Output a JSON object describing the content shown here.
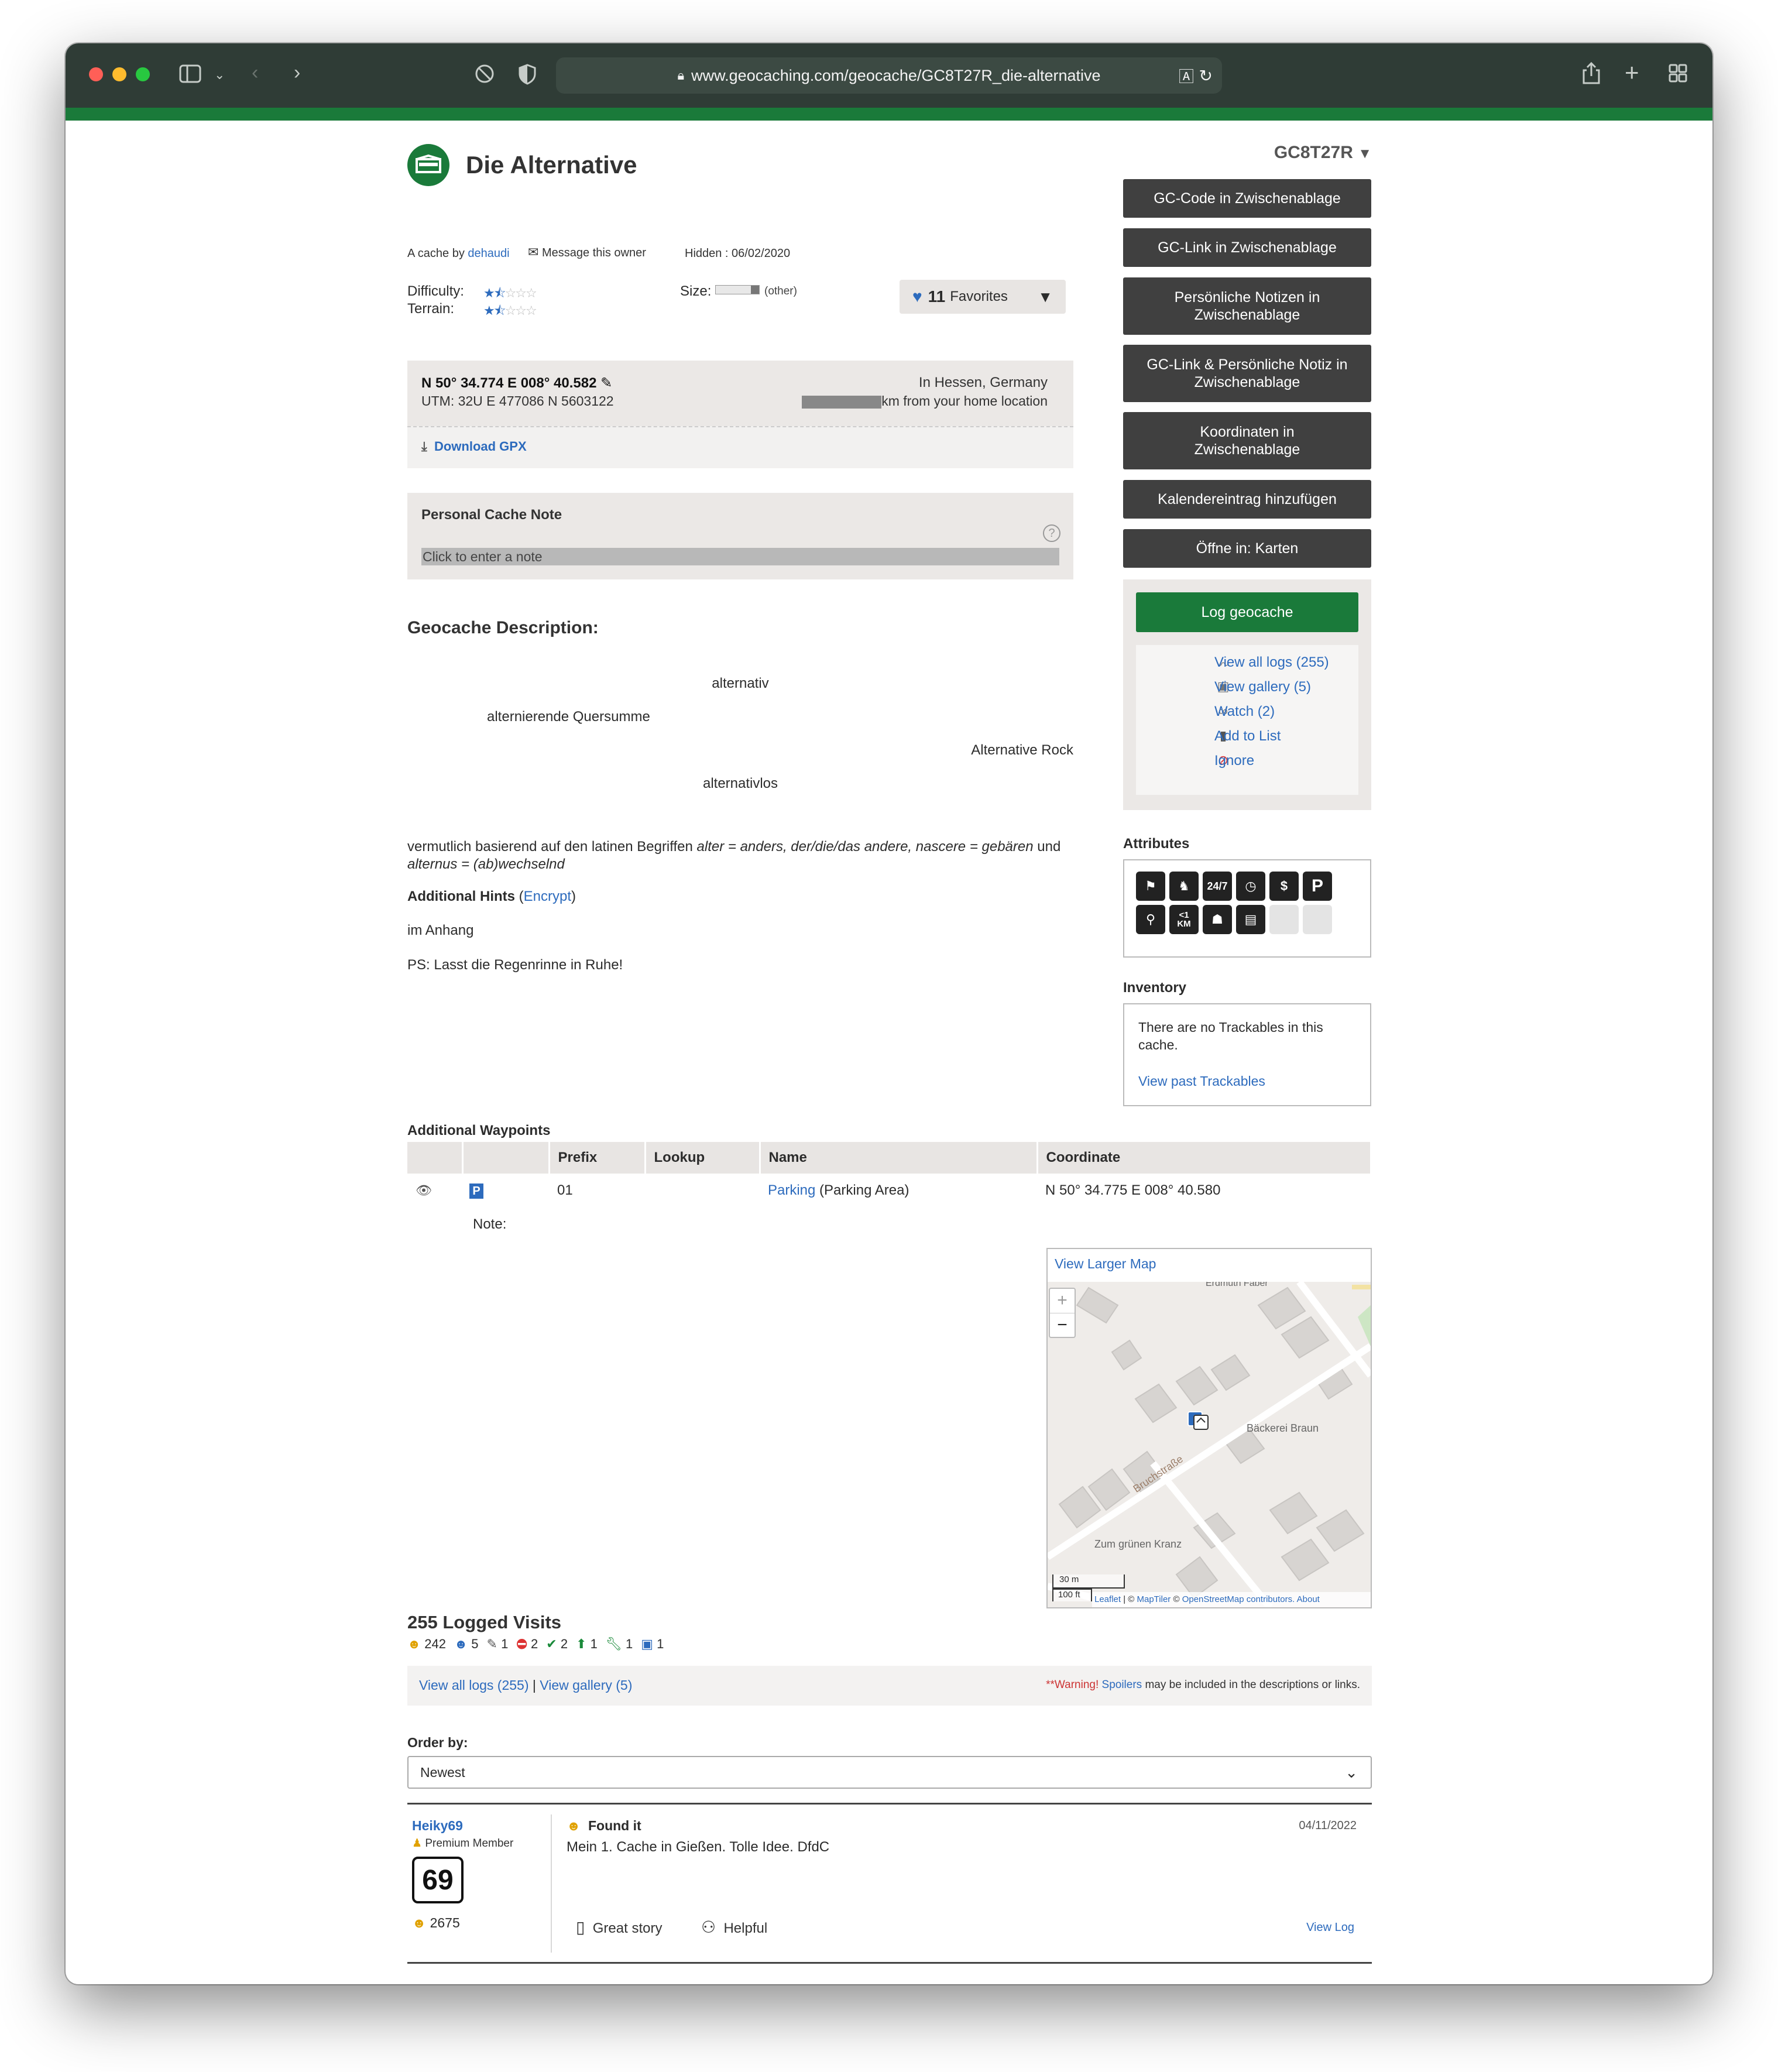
{
  "browser": {
    "url": "www.geocaching.com/geocache/GC8T27R_die-alternative",
    "lock_icon": "lock-icon",
    "translate_icon": "translate-icon"
  },
  "cache": {
    "title": "Die Alternative",
    "gc_code": "GC8T27R",
    "by_prefix": "A cache by",
    "owner": "dehaudi",
    "message_owner": "Message this owner",
    "hidden": "Hidden : 06/02/2020",
    "difficulty_label": "Difficulty:",
    "terrain_label": "Terrain:",
    "difficulty": 1.5,
    "terrain": 1.5,
    "size_label": "Size:",
    "size_value": "(other)",
    "favorites_count": "11",
    "favorites_label": "Favorites"
  },
  "coords": {
    "latlon": "N 50° 34.774 E 008° 40.582",
    "utm": "UTM: 32U E 477086 N 5603122",
    "location": "In Hessen, Germany",
    "distance": "km from your home location",
    "download_gpx": "Download GPX"
  },
  "note": {
    "heading": "Personal Cache Note",
    "placeholder": "Click to enter a note"
  },
  "description": {
    "heading": "Geocache Description:",
    "line1": "alternativ",
    "line2": "alternierende Quersumme",
    "line3": "Alternative Rock",
    "line4": "alternativlos",
    "para_a": "vermutlich basierend auf den latinen Begriffen ",
    "para_b": "alter = anders, der/die/das andere, nascere = gebären",
    "para_c": " und ",
    "para_d": "alternus = (ab)wechselnd",
    "hints_label": "Additional Hints",
    "encrypt": "Encrypt",
    "hint": "im Anhang",
    "ps": "PS: Lasst die Regenrinne in Ruhe!"
  },
  "sidebar": {
    "buttons": [
      "GC-Code in Zwischenablage",
      "GC-Link in Zwischenablage",
      "Persönliche Notizen in Zwischenablage",
      "GC-Link & Persönliche Notiz in Zwischenablage",
      "Koordinaten in Zwischenablage",
      "Kalendereintrag hinzufügen",
      "Öffne in: Karten"
    ],
    "log_button": "Log geocache",
    "links": {
      "all_logs": "View all logs (255)",
      "gallery": "View gallery (5)",
      "watch": "Watch (2)",
      "add_list": "Add to List",
      "ignore": "Ignore"
    },
    "attributes_heading": "Attributes",
    "attributes": [
      "no-stroller-icon",
      "dogs-icon",
      "24-7-icon",
      "short-hike-icon",
      "parking-fee-icon",
      "parking-icon",
      "bicycles-icon",
      "less-than-1km-icon",
      "stealth-icon",
      "public-transit-icon"
    ],
    "inventory_heading": "Inventory",
    "inventory_text": "There are no Trackables in this cache.",
    "past_trackables": "View past Trackables"
  },
  "waypoints": {
    "heading": "Additional Waypoints",
    "headers": [
      "Prefix",
      "Lookup",
      "Name",
      "Coordinate"
    ],
    "rows": [
      {
        "prefix": "01",
        "lookup": "",
        "name": "Parking",
        "type": "(Parking Area)",
        "coordinate": "N 50° 34.775 E 008° 40.580",
        "note": "Note:"
      }
    ]
  },
  "map": {
    "view_larger": "View Larger Map",
    "zoom_in": "+",
    "zoom_out": "−",
    "poi1": "Bäckerei Braun",
    "poi2": "Zum grünen Kranz",
    "street1": "Bruchstraße",
    "street2": "Erdmuth Faber",
    "scale_m": "30 m",
    "scale_ft": "100 ft",
    "leaflet": "Leaflet",
    "attr_sep1": " | © ",
    "maptiler": "MapTiler",
    "attr_sep2": " © ",
    "osm": "OpenStreetMap contributors.",
    "about": "About"
  },
  "logs": {
    "heading": "255 Logged Visits",
    "counts": [
      "242",
      "5",
      "1",
      "2",
      "2",
      "1",
      "1",
      "1"
    ],
    "view_all": "View all logs (255)",
    "separator": "|",
    "view_gallery": "View gallery (5)",
    "warning_a": "**Warning! ",
    "warning_b": "Spoilers",
    "warning_c": " may be included in the descriptions or links.",
    "order_label": "Order by:",
    "order_value": "Newest"
  },
  "log_entry": {
    "user": "Heiky69",
    "member": "Premium Member",
    "avatar_text": "69",
    "finds": "2675",
    "type": "Found it",
    "date": "04/11/2022",
    "text": "Mein 1. Cache in Gießen. Tolle Idee. DfdC",
    "great_story": "Great story",
    "helpful": "Helpful",
    "view_log": "View Log"
  },
  "colors": {
    "titlebar": "#2f3c36",
    "brand_green": "#1a7a3a",
    "link": "#2d6bbd",
    "dark_button": "#404040"
  }
}
